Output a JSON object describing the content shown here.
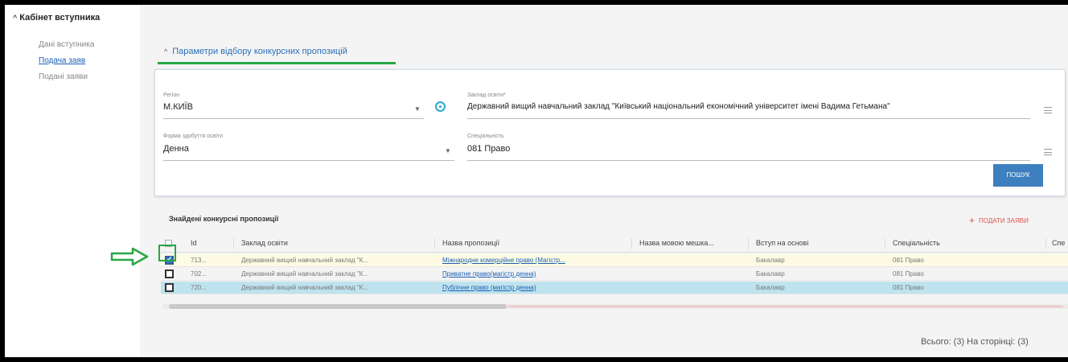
{
  "sidebar": {
    "title": "Кабінет вступника",
    "items": [
      {
        "label": "Дані вступника",
        "active": false
      },
      {
        "label": "Подача заяв",
        "active": true
      },
      {
        "label": "Подані заяви",
        "active": false
      }
    ]
  },
  "filter_section": {
    "toggle_label": "Параметри відбору конкурсних пропозицій",
    "region_label": "Регіон",
    "region_value": "М.КИЇВ",
    "institution_label": "Заклад освіти*",
    "institution_value": "Державний вищий навчальний заклад \"Київський національний економічний університет імені Вадима Гетьмана\"",
    "form_label": "Форма здобуття освіти",
    "form_value": "Денна",
    "specialty_label": "Спеціальність",
    "specialty_value": "081 Право",
    "search_button": "ПОШУК"
  },
  "results": {
    "title": "Знайдені конкурсні пропозиції",
    "submit_label": "ПОДАТИ ЗАЯВИ",
    "columns": [
      "Id",
      "Заклад освіти",
      "Назва пропозиції",
      "Назва мовою мешка...",
      "Вступ на основі",
      "Спеціальність",
      "Спе"
    ],
    "rows": [
      {
        "id": "713...",
        "institution": "Державний вищий навчальний заклад \"К...",
        "offer": "Міжнародне комерційне право (Магістр...",
        "offer_lang": "",
        "basis": "Бакалавр",
        "specialty": "081 Право",
        "checked": true
      },
      {
        "id": "702...",
        "institution": "Державний вищий навчальний заклад \"К...",
        "offer": "Приватне право(магістр денна)",
        "offer_lang": "",
        "basis": "Бакалавр",
        "specialty": "081 Право",
        "checked": false
      },
      {
        "id": "720...",
        "institution": "Державний вищий навчальний заклад \"К...",
        "offer": "Публічне право (магістр денна)",
        "offer_lang": "",
        "basis": "Бакалавр",
        "specialty": "081 Право",
        "checked": false
      }
    ],
    "total_label": "Всього: (3) На сторінці: (3)"
  },
  "colors": {
    "accent": "#3d7fbf",
    "link": "#1a5fb4",
    "annotation_green": "#28a745",
    "row_highlight": "#bfe3ee",
    "row_selected": "#fdfbe3",
    "submit_red": "#d9534f"
  },
  "icons": {
    "globe": "globe-icon",
    "menu": "menu-icon",
    "chevron_up": "chevron-up-icon",
    "dropdown": "caret-down-icon",
    "plus": "plus-icon",
    "arrow": "arrow-right-icon"
  }
}
